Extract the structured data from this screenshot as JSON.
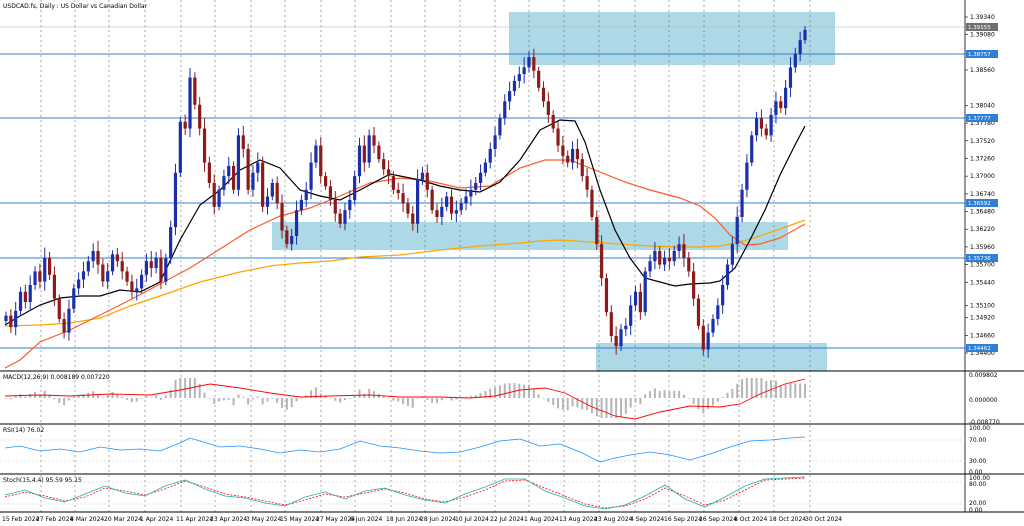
{
  "chart_data": {
    "type": "candlestick",
    "instrument": "USDCAD.fs, Daily : US Dollar vs Canadian Dollar",
    "y_ticks": [
      "1.39340",
      "1.39080",
      "1.38560",
      "1.38040",
      "1.37780",
      "1.37520",
      "1.37260",
      "1.37000",
      "1.36740",
      "1.36480",
      "1.36220",
      "1.35960",
      "1.35700",
      "1.35440",
      "1.35100",
      "1.34920",
      "1.34660",
      "1.34400"
    ],
    "price_labels": [
      "1.39155",
      "1.38757",
      "1.37777",
      "1.36592",
      "1.35736",
      "1.34462"
    ],
    "x_labels": [
      "15 Feb 2024",
      "27 Feb 2024",
      "8 Mar 2024",
      "20 Mar 2024",
      "1 Apr 2024",
      "11 Apr 2024",
      "23 Apr 2024",
      "3 May 2024",
      "15 May 2024",
      "27 May 2024",
      "6 Jun 2024",
      "18 Jun 2024",
      "28 Jun 2024",
      "10 Jul 2024",
      "22 Jul 2024",
      "1 Aug 2024",
      "13 Aug 2024",
      "23 Aug 2024",
      "4 Sep 2024",
      "16 Sep 2024",
      "26 Sep 2024",
      "8 Oct 2024",
      "18 Oct 2024",
      "30 Oct 2024"
    ],
    "closes": [
      1.3495,
      1.3478,
      1.3502,
      1.353,
      1.3515,
      1.354,
      1.356,
      1.3545,
      1.358,
      1.3555,
      1.352,
      1.349,
      1.347,
      1.3505,
      1.3535,
      1.3548,
      1.356,
      1.3575,
      1.359,
      1.357,
      1.3545,
      1.356,
      1.3585,
      1.3575,
      1.356,
      1.3545,
      1.353,
      1.3535,
      1.3555,
      1.3575,
      1.3565,
      1.358,
      1.3545,
      1.358,
      1.3625,
      1.3705,
      1.378,
      1.377,
      1.3845,
      1.3805,
      1.377,
      1.372,
      1.369,
      1.3655,
      1.368,
      1.37,
      1.3715,
      1.368,
      1.376,
      1.374,
      1.368,
      1.3705,
      1.372,
      1.3655,
      1.367,
      1.369,
      1.366,
      1.362,
      1.36,
      1.3612,
      1.365,
      1.3665,
      1.368,
      1.372,
      1.3745,
      1.37,
      1.3685,
      1.3665,
      1.3645,
      1.363,
      1.365,
      1.3665,
      1.37,
      1.3745,
      1.372,
      1.376,
      1.3745,
      1.3725,
      1.371,
      1.37,
      1.368,
      1.3675,
      1.366,
      1.3645,
      1.363,
      1.3695,
      1.3705,
      1.368,
      1.365,
      1.364,
      1.3655,
      1.367,
      1.3645,
      1.365,
      1.366,
      1.367,
      1.368,
      1.369,
      1.3705,
      1.372,
      1.374,
      1.376,
      1.3785,
      1.381,
      1.3825,
      1.384,
      1.385,
      1.386,
      1.3875,
      1.3855,
      1.383,
      1.381,
      1.379,
      1.377,
      1.3745,
      1.373,
      1.372,
      1.374,
      1.3725,
      1.37,
      1.368,
      1.364,
      1.36,
      1.355,
      1.35,
      1.3465,
      1.345,
      1.3475,
      1.348,
      1.351,
      1.353,
      1.35,
      1.356,
      1.3575,
      1.359,
      1.357,
      1.358,
      1.3575,
      1.359,
      1.36,
      1.358,
      1.356,
      1.352,
      1.348,
      1.3445,
      1.347,
      1.349,
      1.351,
      1.354,
      1.357,
      1.36,
      1.364,
      1.368,
      1.372,
      1.376,
      1.3785,
      1.377,
      1.376,
      1.379,
      1.381,
      1.38,
      1.383,
      1.386,
      1.388,
      1.39,
      1.3915
    ]
  },
  "indicators": {
    "macd": {
      "label": "MACD(12,26,9) 0.008189 0.007220",
      "ticks": [
        "0.009802",
        "0.000000",
        "-0.008770"
      ]
    },
    "rsi": {
      "label": "RSI(14) 76.02",
      "ticks": [
        "100.00",
        "70.00",
        "30.00",
        "0.00"
      ]
    },
    "stoch": {
      "label": "Stoch(15,4,4) 95.59 95.15",
      "ticks": [
        "100.00",
        "80.00",
        "20.00",
        "0.00"
      ]
    }
  },
  "colors": {
    "bull": "#1a2fa8",
    "bear": "#8b1a1a",
    "level": "#2e7fd8",
    "zone": "#add8e6",
    "ma_fast": "#000000",
    "ma_mid": "#ff5a28",
    "ma_slow": "#ffa500",
    "macd_signal": "#ff0000",
    "rsi": "#1e90ff",
    "stoch_main": "#20b2aa",
    "stoch_signal": "#ff0000"
  }
}
